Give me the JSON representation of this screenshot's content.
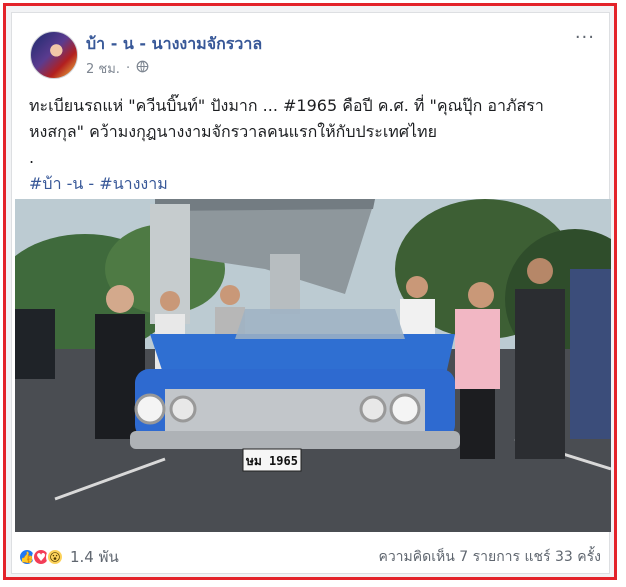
{
  "post": {
    "page_name": "บ้า - น - นางงามจักรวาล",
    "time": "2 ชม.",
    "privacy_icon": "globe-icon",
    "more_label": "···",
    "text_line1": "ทะเบียนรถแห่ \"ควีนบิ๊นท์\" ปังมาก ... #1965 คือปี ค.ศ. ที่ \"คุณปุ๊ก อาภัสรา",
    "text_line2": "หงสกุล\" คว้ามงกุฎนางงามจักรวาลคนแรกให้กับประเทศไทย",
    "text_line3": ".",
    "hashtags": "#บ้า -น - #นางงาม",
    "photo": {
      "license_plate": "ษม 1965"
    }
  },
  "footer": {
    "reactions": [
      "like-icon",
      "love-icon",
      "wow-icon"
    ],
    "reaction_count": "1.4 พัน",
    "comments": "ความคิดเห็น 7 รายการ",
    "shares": "แชร์ 33 ครั้ง"
  }
}
